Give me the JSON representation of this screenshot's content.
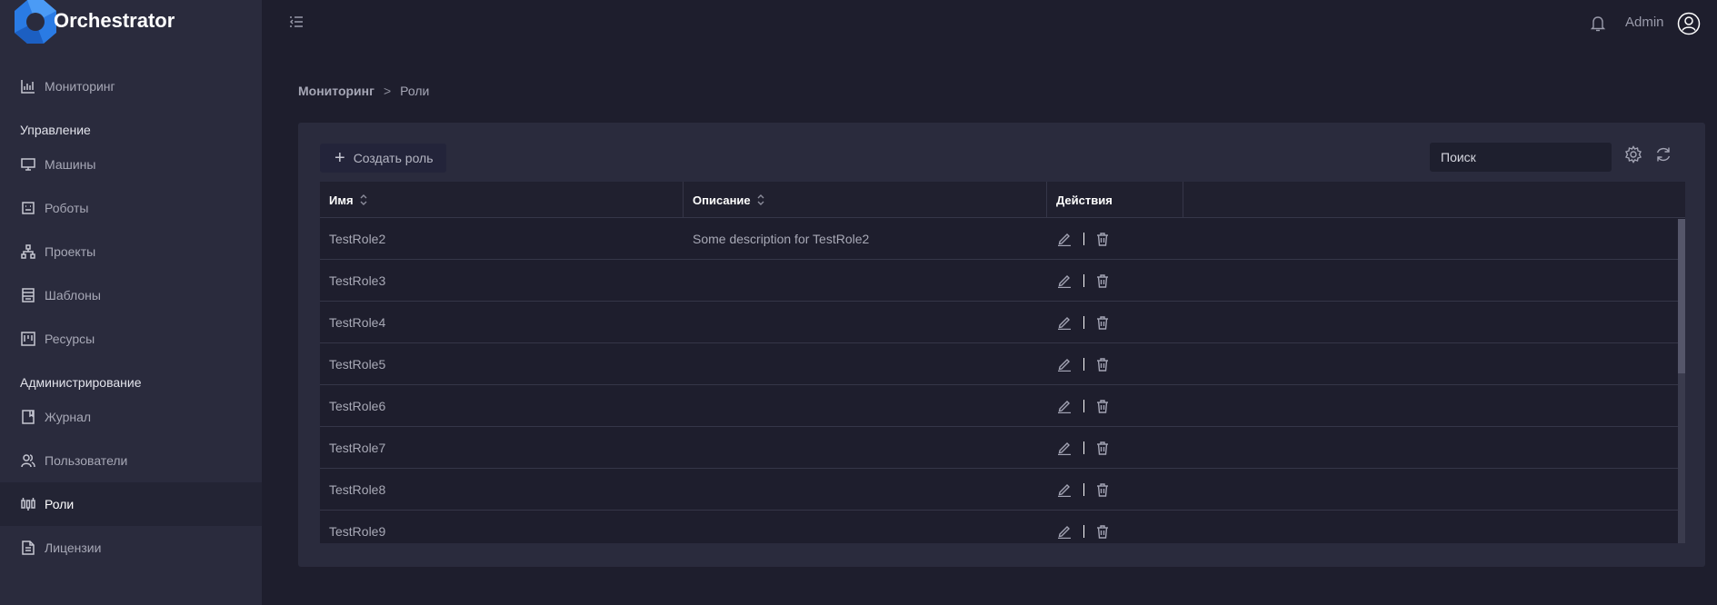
{
  "app": {
    "title": "Orchestrator"
  },
  "header": {
    "user_name": "Admin"
  },
  "sidebar": {
    "monitoring": "Мониторинг",
    "section_manage": "Управление",
    "manage_items": [
      {
        "label": "Машины",
        "icon": "monitor-icon"
      },
      {
        "label": "Роботы",
        "icon": "robot-icon"
      },
      {
        "label": "Проекты",
        "icon": "hierarchy-icon"
      },
      {
        "label": "Шаблоны",
        "icon": "template-icon"
      },
      {
        "label": "Ресурсы",
        "icon": "resource-icon"
      }
    ],
    "section_admin": "Администрирование",
    "admin_items": [
      {
        "label": "Журнал",
        "icon": "journal-icon"
      },
      {
        "label": "Пользователи",
        "icon": "users-icon"
      },
      {
        "label": "Роли",
        "icon": "roles-icon",
        "active": true
      },
      {
        "label": "Лицензии",
        "icon": "license-icon"
      }
    ]
  },
  "breadcrumb": {
    "parent": "Мониторинг",
    "separator": ">",
    "current": "Роли"
  },
  "toolbar": {
    "create_label": "Создать роль",
    "create_icon": "+",
    "search_placeholder": "Поиск"
  },
  "table": {
    "columns": {
      "name": "Имя",
      "description": "Описание",
      "actions": "Действия"
    },
    "rows": [
      {
        "name": "TestRole2",
        "description": "Some description for TestRole2"
      },
      {
        "name": "TestRole3",
        "description": ""
      },
      {
        "name": "TestRole4",
        "description": ""
      },
      {
        "name": "TestRole5",
        "description": ""
      },
      {
        "name": "TestRole6",
        "description": ""
      },
      {
        "name": "TestRole7",
        "description": ""
      },
      {
        "name": "TestRole8",
        "description": ""
      },
      {
        "name": "TestRole9",
        "description": ""
      }
    ]
  },
  "colors": {
    "background": "#1e1e2d",
    "sidebar": "#2a2b3d",
    "panel": "#2a2b3d",
    "logo_blue": "#2a7be4"
  }
}
